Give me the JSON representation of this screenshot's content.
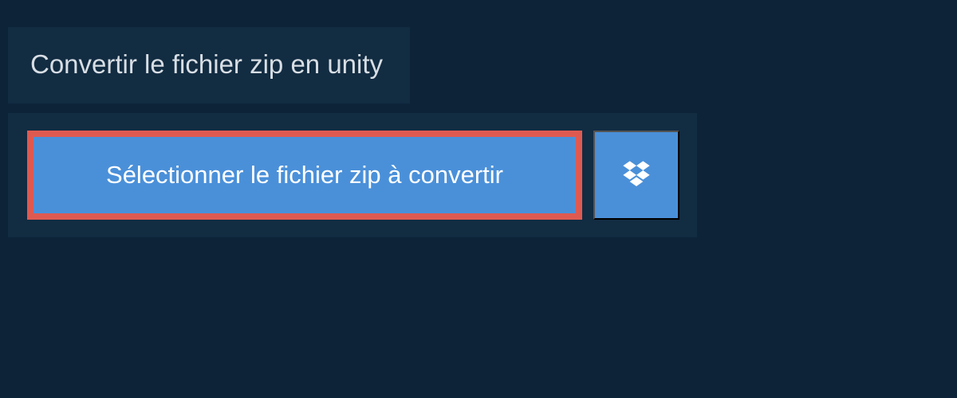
{
  "header": {
    "title": "Convertir le fichier zip en unity"
  },
  "buttons": {
    "select_file_label": "Sélectionner le fichier zip à convertir"
  }
}
